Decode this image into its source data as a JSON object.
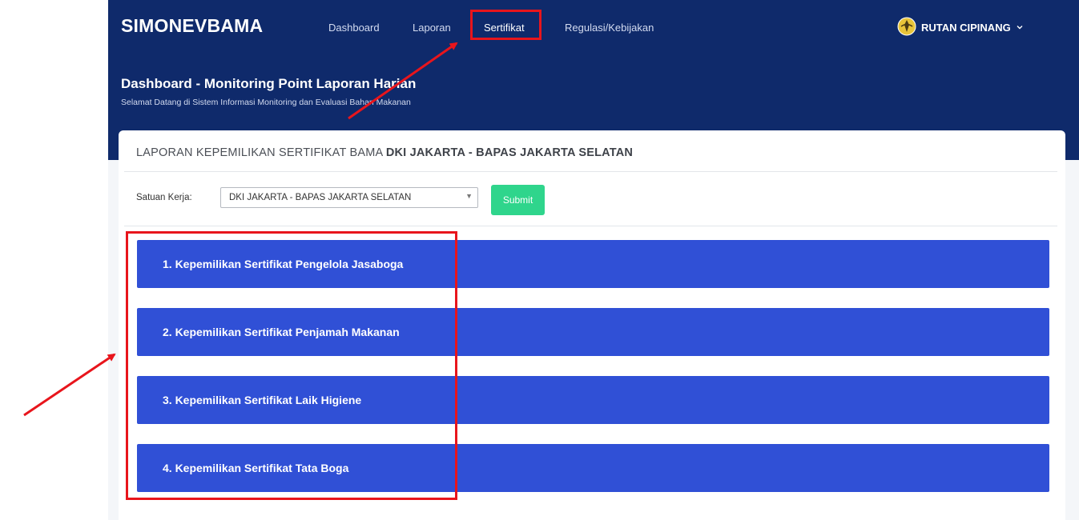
{
  "app": {
    "brand": "SIMONEVBAMA"
  },
  "nav": {
    "items": [
      {
        "label": "Dashboard"
      },
      {
        "label": "Laporan"
      },
      {
        "label": "Sertifikat"
      },
      {
        "label": "Regulasi/Kebijakan"
      }
    ],
    "active": "Sertifikat"
  },
  "user": {
    "name": "RUTAN CIPINANG",
    "icon": "logo-emblem-icon"
  },
  "header": {
    "title": "Dashboard - Monitoring Point Laporan Harian",
    "subtitle": "Selamat Datang di Sistem Informasi Monitoring dan Evaluasi Bahan Makanan"
  },
  "card": {
    "title_prefix": "LAPORAN KEPEMILIKAN SERTIFIKAT BAMA",
    "title_region": "DKI JAKARTA - BAPAS JAKARTA SELATAN",
    "filter": {
      "label": "Satuan Kerja:",
      "value": "DKI JAKARTA - BAPAS JAKARTA SELATAN",
      "submit_label": "Submit"
    },
    "sections": [
      {
        "label": "1. Kepemilikan Sertifikat Pengelola Jasaboga"
      },
      {
        "label": "2. Kepemilikan Sertifikat Penjamah Makanan"
      },
      {
        "label": "3. Kepemilikan Sertifikat Laik Higiene"
      },
      {
        "label": "4. Kepemilikan Sertifikat Tata Boga"
      }
    ]
  },
  "colors": {
    "banner": "#0f2a6b",
    "accordion": "#3050d6",
    "submit": "#2fd58c",
    "annotation": "#e8151c"
  }
}
